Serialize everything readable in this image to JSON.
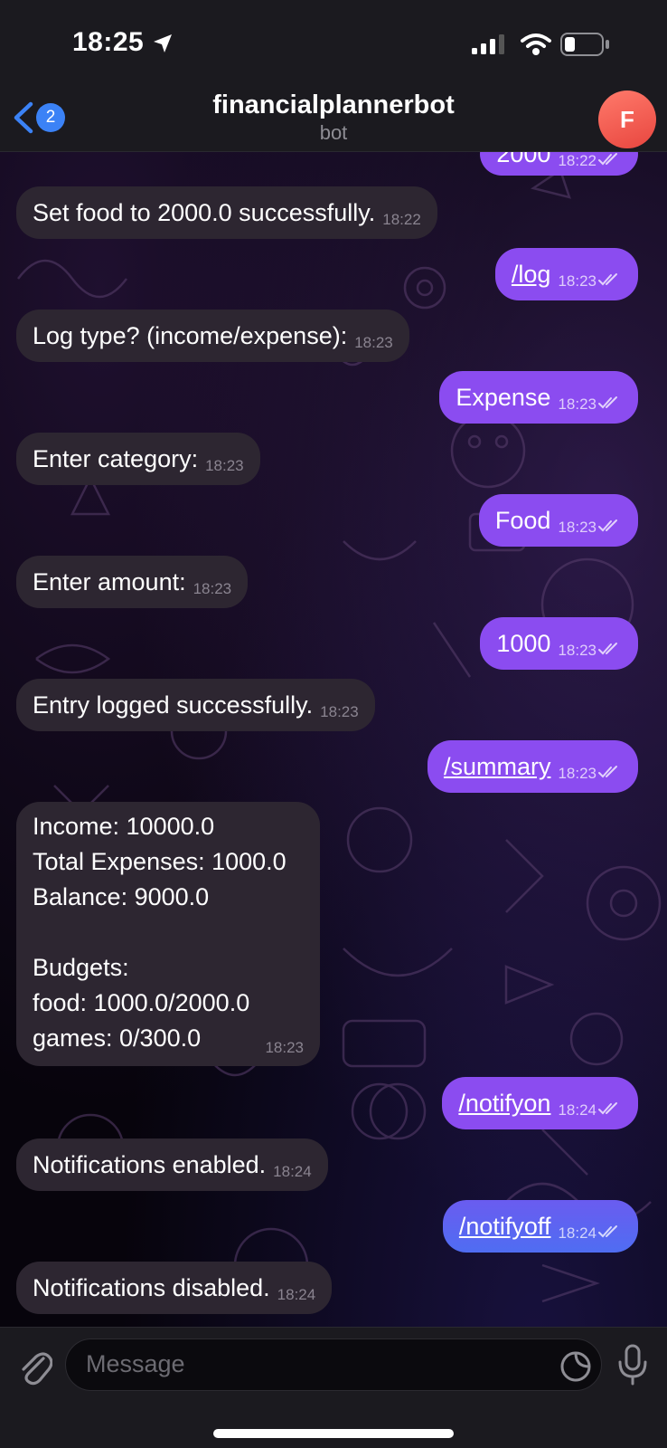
{
  "status_bar": {
    "time": "18:25"
  },
  "header": {
    "back_count": "2",
    "title": "financialplannerbot",
    "subtitle": "bot",
    "avatar_letter": "F",
    "avatar_color": "#f0544a"
  },
  "colors": {
    "incoming_bubble": "#2d2631",
    "outgoing_bubble_top": "#8b4cf0",
    "outgoing_bubble_bottom": "#4f6df2"
  },
  "messages": [
    {
      "from": "me",
      "text": "2000",
      "time": "18:22"
    },
    {
      "from": "bot",
      "text": "Set food to 2000.0 successfully.",
      "time": "18:22"
    },
    {
      "from": "me",
      "text": "/log",
      "time": "18:23"
    },
    {
      "from": "bot",
      "text": "Log type? (income/expense):",
      "time": "18:23"
    },
    {
      "from": "me",
      "text": "Expense",
      "time": "18:23"
    },
    {
      "from": "bot",
      "text": "Enter category:",
      "time": "18:23"
    },
    {
      "from": "me",
      "text": "Food",
      "time": "18:23"
    },
    {
      "from": "bot",
      "text": "Enter amount:",
      "time": "18:23"
    },
    {
      "from": "me",
      "text": "1000",
      "time": "18:23"
    },
    {
      "from": "bot",
      "text": "Entry logged successfully.",
      "time": "18:23"
    },
    {
      "from": "me",
      "text": "/summary",
      "time": "18:23"
    },
    {
      "from": "bot",
      "lines": [
        "Income: 10000.0",
        "Total Expenses: 1000.0",
        "Balance: 9000.0",
        "",
        "Budgets:",
        "food: 1000.0/2000.0",
        "games: 0/300.0"
      ],
      "time": "18:23"
    },
    {
      "from": "me",
      "text": "/notifyon",
      "time": "18:24"
    },
    {
      "from": "bot",
      "text": "Notifications enabled.",
      "time": "18:24"
    },
    {
      "from": "me",
      "text": "/notifyoff",
      "time": "18:24"
    },
    {
      "from": "bot",
      "text": "Notifications disabled.",
      "time": "18:24"
    }
  ],
  "input": {
    "placeholder": "Message"
  }
}
